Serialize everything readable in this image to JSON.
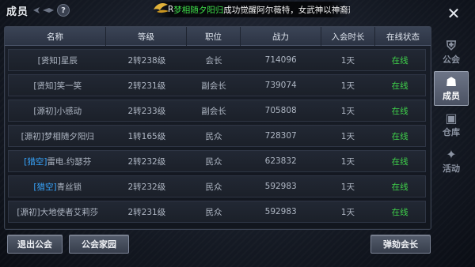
{
  "header": {
    "title": "成员",
    "help_label": "?",
    "ticker_prefix": "R",
    "ticker_name": "梦相随夕阳归",
    "ticker_text": "成功觉醒阿尔薇特，女武神以神裔形态"
  },
  "close_label": "✕",
  "table": {
    "headers": [
      "名称",
      "等级",
      "职位",
      "战力",
      "入会时长",
      "在线状态"
    ],
    "rows": [
      {
        "prefix": "[贤知]",
        "prefix_style": "normal",
        "name": "星辰",
        "level": "2转238级",
        "position": "会长",
        "power": "714096",
        "duration": "1天",
        "status": "在线"
      },
      {
        "prefix": "[贤知]",
        "prefix_style": "normal",
        "name": "笑一笑",
        "level": "2转231级",
        "position": "副会长",
        "power": "739074",
        "duration": "1天",
        "status": "在线"
      },
      {
        "prefix": "[源初]",
        "prefix_style": "normal",
        "name": "小感动",
        "level": "2转233级",
        "position": "副会长",
        "power": "705808",
        "duration": "1天",
        "status": "在线"
      },
      {
        "prefix": "[源初]",
        "prefix_style": "normal",
        "name": "梦相随夕阳归",
        "level": "1转165级",
        "position": "民众",
        "power": "728307",
        "duration": "1天",
        "status": "在线"
      },
      {
        "prefix": "[猎空]",
        "prefix_style": "blue",
        "name": "雷电.约瑟芬",
        "level": "2转232级",
        "position": "民众",
        "power": "623832",
        "duration": "1天",
        "status": "在线"
      },
      {
        "prefix": "[猎空]",
        "prefix_style": "blue",
        "name": "青丝锁",
        "level": "2转232级",
        "position": "民众",
        "power": "592983",
        "duration": "1天",
        "status": "在线"
      },
      {
        "prefix": "[源初]",
        "prefix_style": "normal",
        "name": "大地使者艾莉莎",
        "level": "2转231级",
        "position": "民众",
        "power": "592983",
        "duration": "1天",
        "status": "在线"
      }
    ]
  },
  "side_tabs": [
    {
      "label": "公会",
      "icon": "guild-icon",
      "glyph": "⛨",
      "active": false
    },
    {
      "label": "成员",
      "icon": "members-icon",
      "glyph": "☗",
      "active": true
    },
    {
      "label": "仓库",
      "icon": "warehouse-icon",
      "glyph": "▣",
      "active": false
    },
    {
      "label": "活动",
      "icon": "activity-icon",
      "glyph": "✦",
      "active": false
    }
  ],
  "buttons": {
    "leave": "退出公会",
    "home": "公会家园",
    "impeach": "弹劾会长"
  },
  "colors": {
    "online": "#3fd24a",
    "prefix_blue": "#37a6ff",
    "ticker_highlight": "#3fe04a"
  }
}
